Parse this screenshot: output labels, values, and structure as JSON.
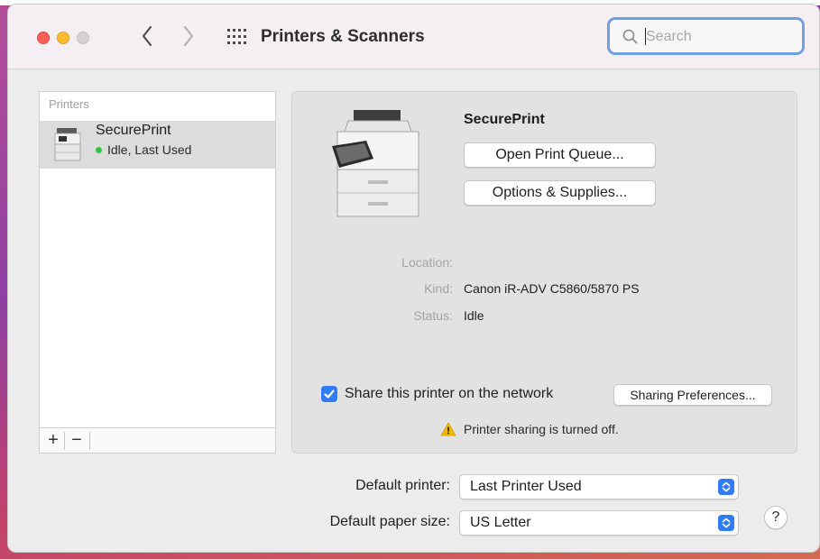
{
  "window": {
    "title": "Printers & Scanners",
    "search_placeholder": "Search"
  },
  "printers_list": {
    "header": "Printers",
    "items": [
      {
        "name": "SecurePrint",
        "status": "Idle, Last Used",
        "status_color": "#2ec540"
      }
    ],
    "add_label": "+",
    "remove_label": "−"
  },
  "detail": {
    "printer_name": "SecurePrint",
    "open_queue_label": "Open Print Queue...",
    "options_label": "Options & Supplies...",
    "location_label": "Location:",
    "location_value": "",
    "kind_label": "Kind:",
    "kind_value": "Canon iR-ADV C5860/5870 PS",
    "status_label": "Status:",
    "status_value": "Idle",
    "share_label": "Share this printer on the network",
    "share_checked": true,
    "sharing_prefs_label": "Sharing Preferences...",
    "sharing_warning": "Printer sharing is turned off."
  },
  "defaults": {
    "printer_label": "Default printer:",
    "printer_value": "Last Printer Used",
    "paper_label": "Default paper size:",
    "paper_value": "US Letter"
  },
  "help_label": "?",
  "colors": {
    "accent": "#2f7cf6",
    "warning": "#f5b800",
    "status_green": "#2ec540"
  },
  "icons": {
    "back": "chevron-left-icon",
    "forward": "chevron-right-icon",
    "grid": "grid-icon",
    "search": "search-icon",
    "warning": "warning-icon",
    "printer": "printer-icon"
  }
}
